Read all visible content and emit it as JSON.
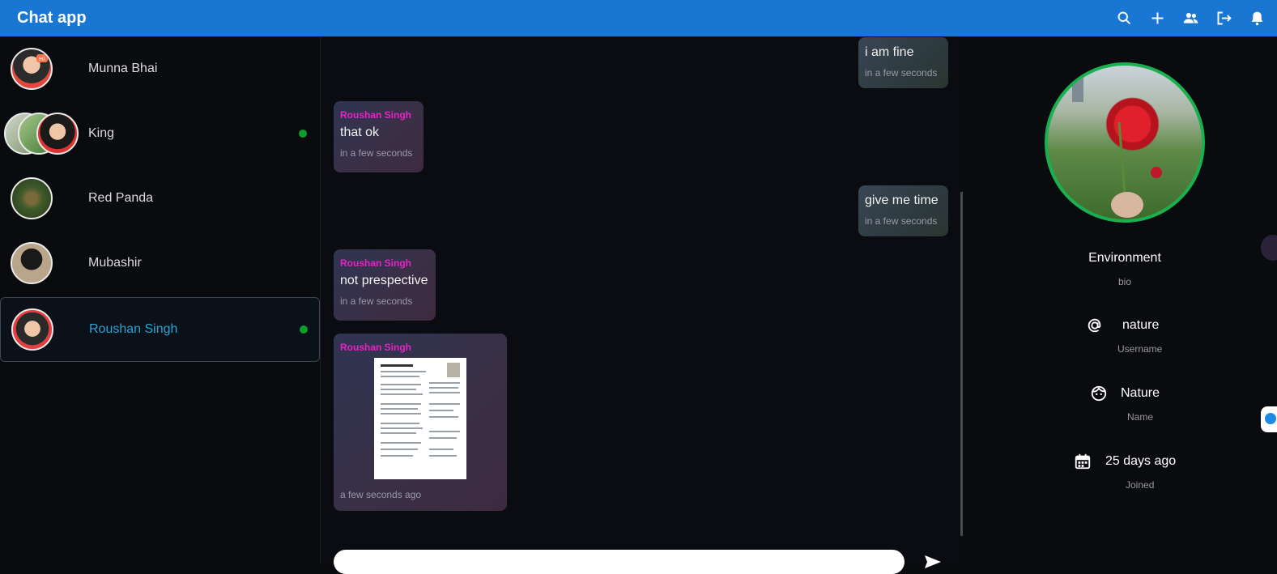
{
  "app": {
    "title": "Chat app"
  },
  "toolbar_icons": [
    "search-icon",
    "add-icon",
    "group-icon",
    "logout-icon",
    "notifications-icon"
  ],
  "sidebar": {
    "contacts": [
      {
        "name": "Munna Bhai",
        "online": false,
        "active": false
      },
      {
        "name": "King",
        "online": true,
        "active": false
      },
      {
        "name": "Red Panda",
        "online": false,
        "active": false
      },
      {
        "name": "Mubashir",
        "online": false,
        "active": false
      },
      {
        "name": "Roushan Singh",
        "online": true,
        "active": true
      }
    ]
  },
  "messages": [
    {
      "direction": "out",
      "text": "i am fine",
      "time": "in a few seconds"
    },
    {
      "direction": "in",
      "sender": "Roushan Singh",
      "text": "that ok",
      "time": "in a few seconds"
    },
    {
      "direction": "out",
      "text": "give me time",
      "time": "in a few seconds"
    },
    {
      "direction": "in",
      "sender": "Roushan Singh",
      "text": "not prespective",
      "time": "in a few seconds"
    },
    {
      "direction": "in",
      "sender": "Roushan Singh",
      "attachment": "document",
      "time": "a few seconds ago"
    }
  ],
  "profile": {
    "title": "Environment",
    "bio_label": "bio",
    "username": "nature",
    "username_label": "Username",
    "name": "Nature",
    "name_label": "Name",
    "joined": "25 days ago",
    "joined_label": "Joined"
  },
  "colors": {
    "appbar": "#1976d2",
    "accent_sender": "#e524c6",
    "online": "#0f9d2a",
    "profile_ring": "#19b14f",
    "active_name": "#2aa3d6"
  }
}
